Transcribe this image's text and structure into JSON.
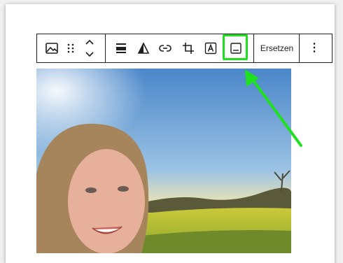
{
  "toolbar": {
    "replace_label": "Ersetzen",
    "more_label": "⋮"
  },
  "annotation": {
    "highlight_color": "#1fe01f"
  }
}
